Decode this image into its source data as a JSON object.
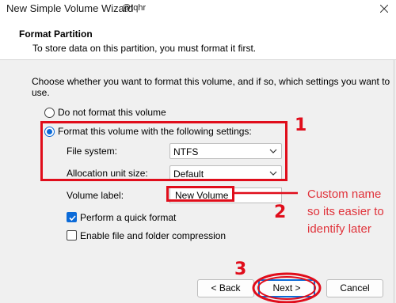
{
  "window": {
    "title": "New Simple Volume Wizard",
    "tag": "@tqhr",
    "close_icon": "close-icon"
  },
  "header": {
    "title": "Format Partition",
    "subtitle": "To store data on this partition, you must format it first."
  },
  "body": {
    "instruction": "Choose whether you want to format this volume, and if so, which settings you want to use.",
    "option_no_format": "Do not format this volume",
    "option_format": "Format this volume with the following settings:",
    "selected_option": "format",
    "file_system_label": "File system:",
    "file_system_value": "NTFS",
    "alloc_label": "Allocation unit size:",
    "alloc_value": "Default",
    "volume_label_label": "Volume label:",
    "volume_label_value": "New Volume",
    "quick_format_label": "Perform a quick format",
    "quick_format_checked": true,
    "compression_label": "Enable file and folder compression",
    "compression_checked": false
  },
  "buttons": {
    "back": "< Back",
    "next": "Next >",
    "cancel": "Cancel"
  },
  "annotations": {
    "num1": "1",
    "num2": "2",
    "num3": "3",
    "note_line1": "Custom name",
    "note_line2": "so its easier to",
    "note_line3": "identify later",
    "color": "#e00d1b"
  },
  "colors": {
    "accent": "#0b6ad8",
    "window_bg": "#f0f0f0",
    "header_bg": "#ffffff"
  }
}
